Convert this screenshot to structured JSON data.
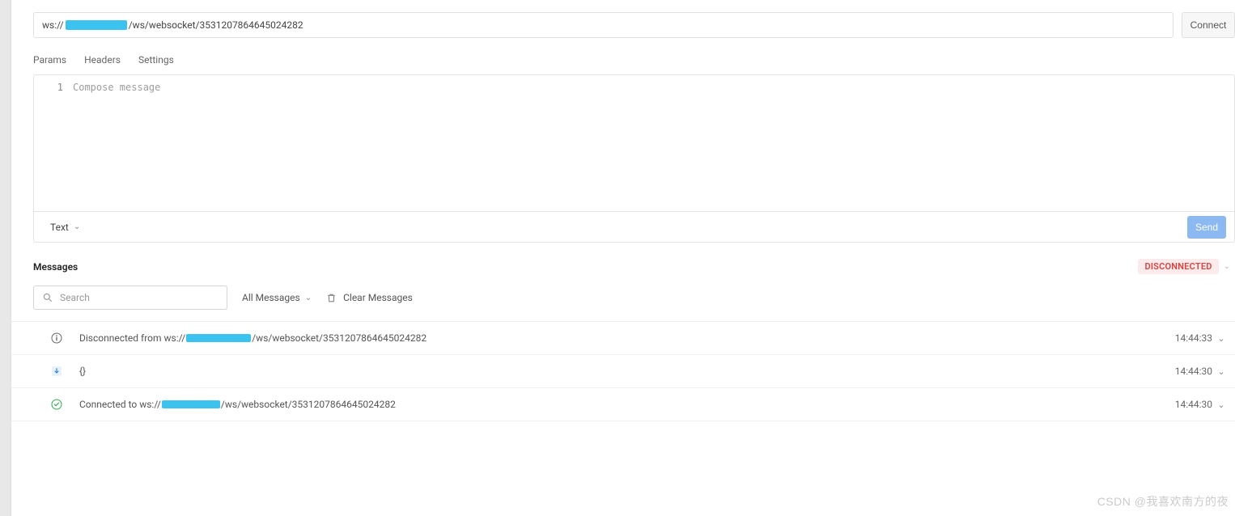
{
  "url": {
    "prefix": "ws://",
    "suffix": "/ws/websocket/3531207864645024282",
    "connect_label": "Connect"
  },
  "tabs": {
    "params": "Params",
    "headers": "Headers",
    "settings": "Settings"
  },
  "compose": {
    "line_number": "1",
    "placeholder": "Compose message",
    "type_label": "Text",
    "send_label": "Send"
  },
  "messages": {
    "title": "Messages",
    "status": "DISCONNECTED",
    "search_placeholder": "Search",
    "filter_label": "All Messages",
    "clear_label": "Clear Messages",
    "rows": [
      {
        "type": "info",
        "text_prefix": "Disconnected from ws://",
        "text_suffix": "/ws/websocket/3531207864645024282",
        "redact_width": 80,
        "time": "14:44:33"
      },
      {
        "type": "incoming",
        "text_prefix": "{}",
        "text_suffix": "",
        "redact_width": 0,
        "time": "14:44:30"
      },
      {
        "type": "success",
        "text_prefix": "Connected to ws://",
        "text_suffix": "/ws/websocket/3531207864645024282",
        "redact_width": 72,
        "time": "14:44:30"
      }
    ]
  },
  "watermark": "CSDN @我喜欢南方的夜"
}
